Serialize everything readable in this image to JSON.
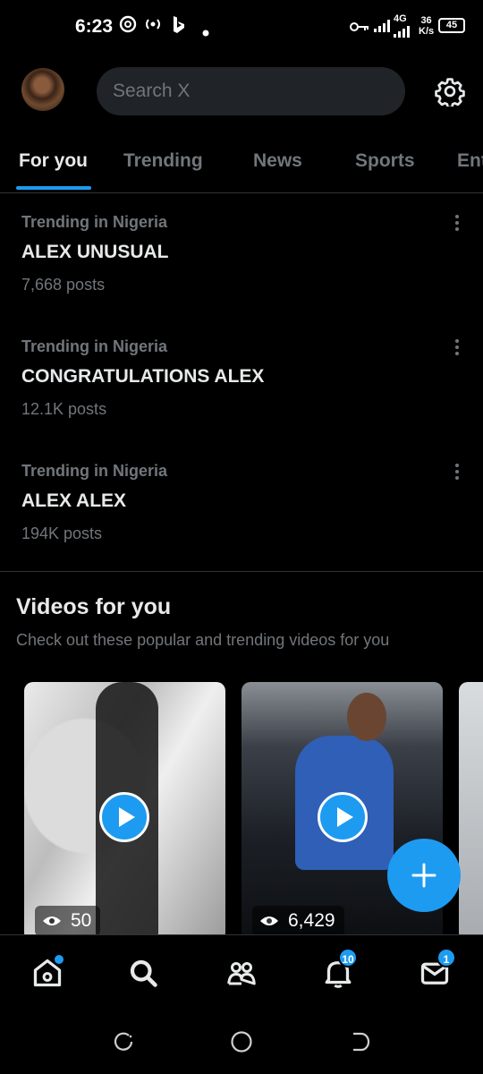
{
  "status_bar": {
    "time": "6:23",
    "network_speed_value": "36",
    "network_speed_unit": "K/s",
    "network_type": "4G",
    "battery": "45",
    "icons": [
      "threads-icon",
      "hotspot-icon",
      "bing-icon",
      "dot-icon",
      "vpn-key-icon",
      "signal-icon"
    ]
  },
  "header": {
    "search_placeholder": "Search X"
  },
  "tabs": [
    {
      "label": "For you",
      "active": true
    },
    {
      "label": "Trending",
      "active": false
    },
    {
      "label": "News",
      "active": false
    },
    {
      "label": "Sports",
      "active": false
    },
    {
      "label": "Ent",
      "active": false
    }
  ],
  "trends": [
    {
      "context": "Trending in Nigeria",
      "name": "ALEX UNUSUAL",
      "count": "7,668 posts"
    },
    {
      "context": "Trending in Nigeria",
      "name": "CONGRATULATIONS ALEX",
      "count": "12.1K posts"
    },
    {
      "context": "Trending in Nigeria",
      "name": "ALEX ALEX",
      "count": "194K posts"
    }
  ],
  "videos_section": {
    "title": "Videos for you",
    "subtitle": "Check out these popular and trending videos for you",
    "videos": [
      {
        "views": "50"
      },
      {
        "views": "6,429"
      }
    ]
  },
  "bottom_nav": {
    "items": [
      "home-icon",
      "search-icon",
      "communities-icon",
      "notifications-icon",
      "messages-icon"
    ],
    "notifications_badge": "10",
    "messages_badge": "1"
  },
  "colors": {
    "accent": "#1d9bf0",
    "background": "#000000",
    "secondary_text": "#71767b",
    "search_bg": "#202327"
  }
}
